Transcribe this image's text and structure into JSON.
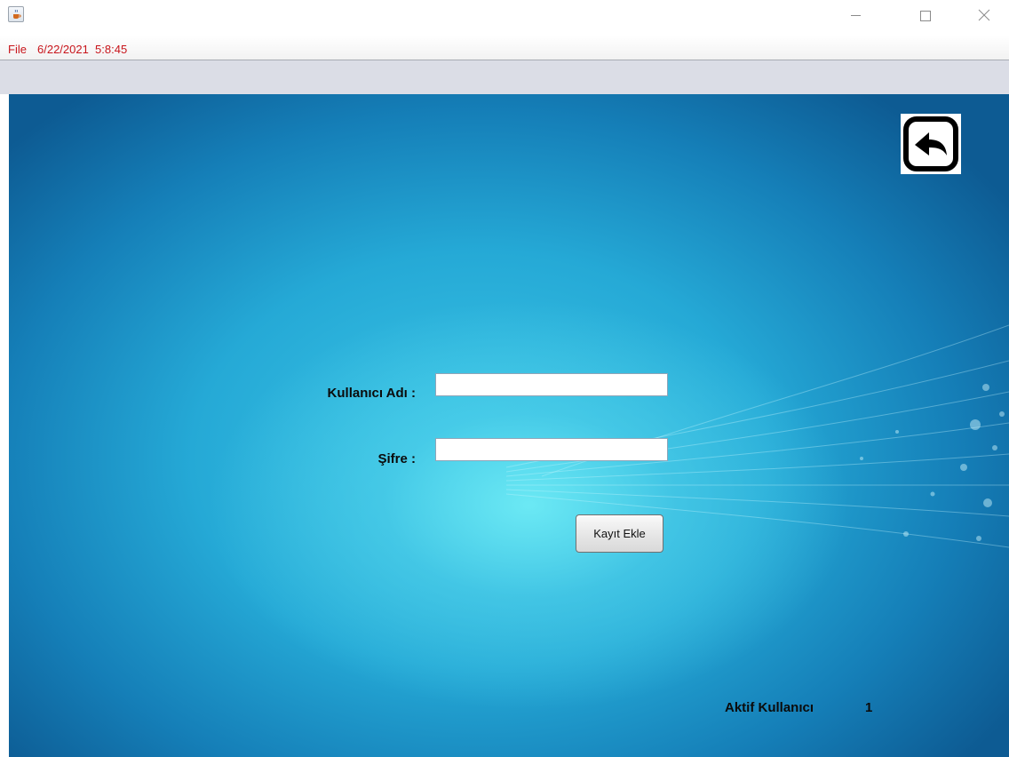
{
  "menubar": {
    "file_label": "File",
    "clock_text": "6/22/2021  5:8:45"
  },
  "form": {
    "username_label": "Kullanıcı Adı :",
    "username_value": "",
    "password_label": "Şifre :",
    "password_value": "",
    "submit_label": "Kayıt Ekle"
  },
  "status": {
    "active_users_label": "Aktif Kullanıcı",
    "active_users_count": "1"
  },
  "icons": {
    "app": "java-cup-icon",
    "back": "back-arrow-icon",
    "minimize": "minimize-icon",
    "maximize": "maximize-icon",
    "close": "close-icon"
  },
  "colors": {
    "menu_text": "#c8151b",
    "content_center": "#6eebf5",
    "content_edge": "#0d5b93",
    "toolstrip": "#dbdde6"
  }
}
